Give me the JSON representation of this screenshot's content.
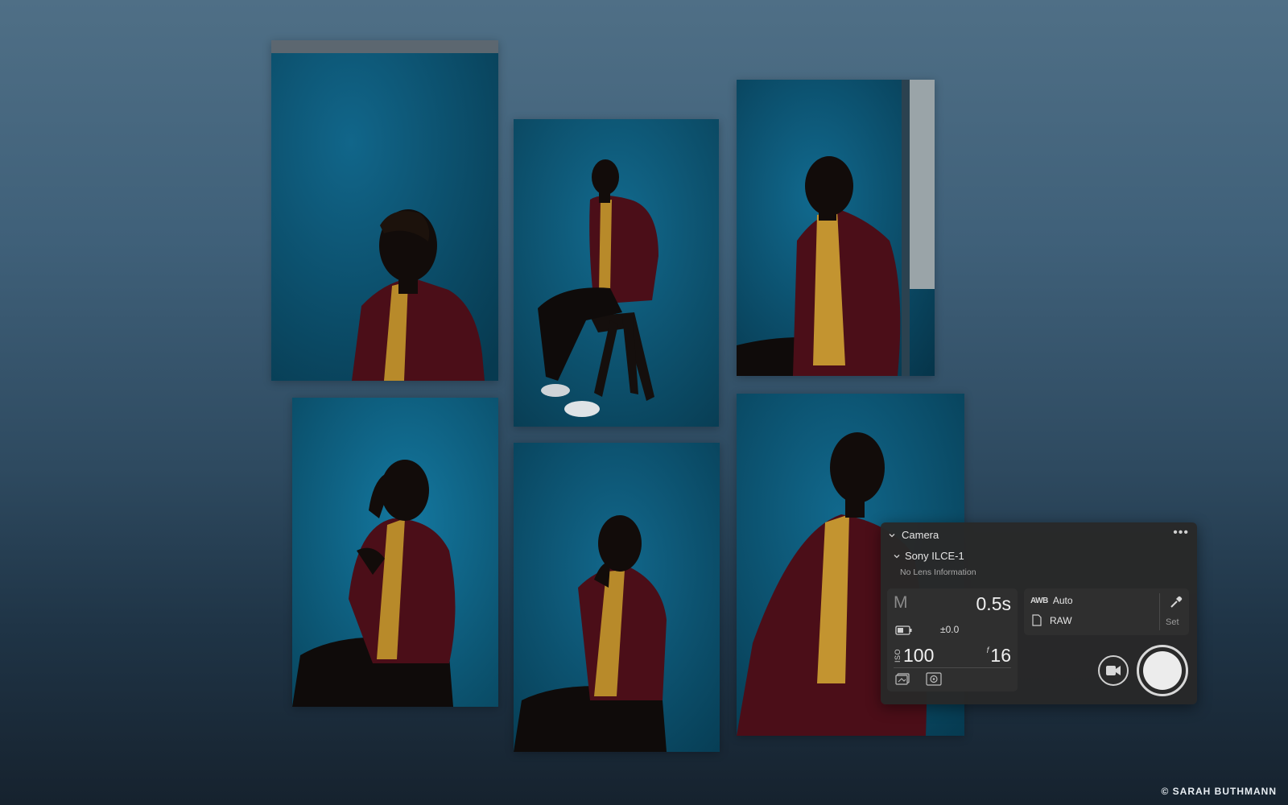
{
  "credit": "© SARAH BUTHMANN",
  "colors": {
    "backdrop_blue": "#0f5a78",
    "jacket_red": "#6e1422",
    "shirt_yellow": "#c9982e",
    "panel_bg": "#282828"
  },
  "photos": [
    {
      "name": "photo-1",
      "description_pose": "profile-closeup"
    },
    {
      "name": "photo-2",
      "description_pose": "seated-stool-full"
    },
    {
      "name": "photo-3",
      "description_pose": "seated-looking-up"
    },
    {
      "name": "photo-4",
      "description_pose": "hand-to-face"
    },
    {
      "name": "photo-5",
      "description_pose": "hand-to-chin"
    },
    {
      "name": "photo-6",
      "description_pose": "profile-large"
    }
  ],
  "camera_panel": {
    "title": "Camera",
    "more_icon": "more-horizontal-icon",
    "camera_name": "Sony ILCE-1",
    "lens_info": "No Lens Information",
    "exposure": {
      "mode": "M",
      "shutter_speed": "0.5s",
      "exposure_comp": "±0.0",
      "iso_label": "ISO",
      "iso_value": "100",
      "f_label": "f",
      "aperture": "16"
    },
    "white_balance": {
      "icon_text": "AWB",
      "value": "Auto",
      "file_format": "RAW",
      "set_label": "Set"
    }
  }
}
